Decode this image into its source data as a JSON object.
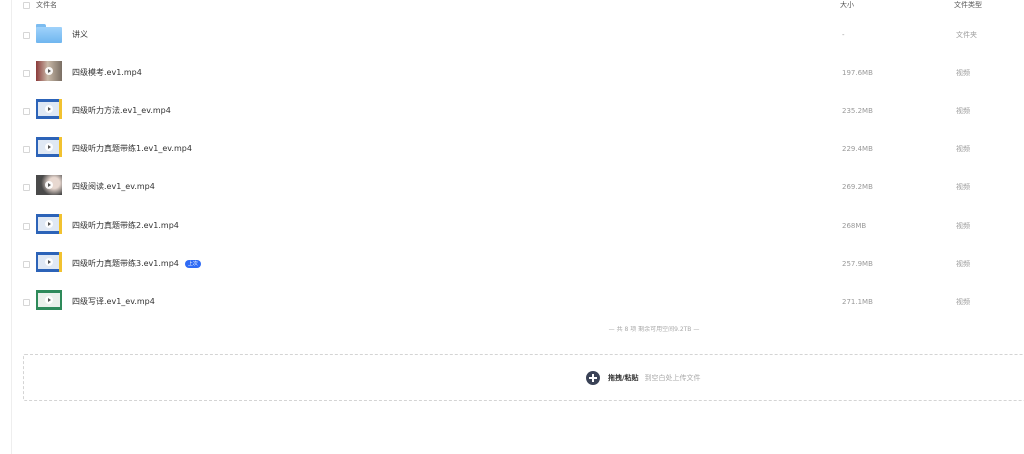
{
  "header": {
    "name_label": "文件名",
    "size_label": "大小",
    "type_label": "文件类型"
  },
  "files": [
    {
      "name": "讲义",
      "size": "-",
      "type": "文件夹",
      "thumb": "folder-icon"
    },
    {
      "name": "四级模考.ev1.mp4",
      "size": "197.6MB",
      "type": "视频",
      "thumb": "video-thumbnail"
    },
    {
      "name": "四级听力方法.ev1_ev.mp4",
      "size": "235.2MB",
      "type": "视频",
      "thumb": "video-thumbnail"
    },
    {
      "name": "四级听力真题带练1.ev1_ev.mp4",
      "size": "229.4MB",
      "type": "视频",
      "thumb": "video-thumbnail"
    },
    {
      "name": "四级阅读.ev1_ev.mp4",
      "size": "269.2MB",
      "type": "视频",
      "thumb": "video-thumbnail"
    },
    {
      "name": "四级听力真题带练2.ev1.mp4",
      "size": "268MB",
      "type": "视频",
      "thumb": "video-thumbnail"
    },
    {
      "name": "四级听力真题带练3.ev1.mp4",
      "size": "257.9MB",
      "type": "视频",
      "thumb": "video-thumbnail",
      "badge": "上次"
    },
    {
      "name": "四级写译.ev1_ev.mp4",
      "size": "271.1MB",
      "type": "视频",
      "thumb": "video-thumbnail"
    }
  ],
  "summary": "— 共 8 项 剩余可用空间9.2TB —",
  "dropzone": {
    "icon": "plus-circle-icon",
    "primary": "拖拽/粘贴",
    "secondary": "到空白处上传文件"
  },
  "colors": {
    "badge": "#2f6bf5",
    "plus_icon": "#3a4256",
    "folder": "#7cbcf0"
  }
}
